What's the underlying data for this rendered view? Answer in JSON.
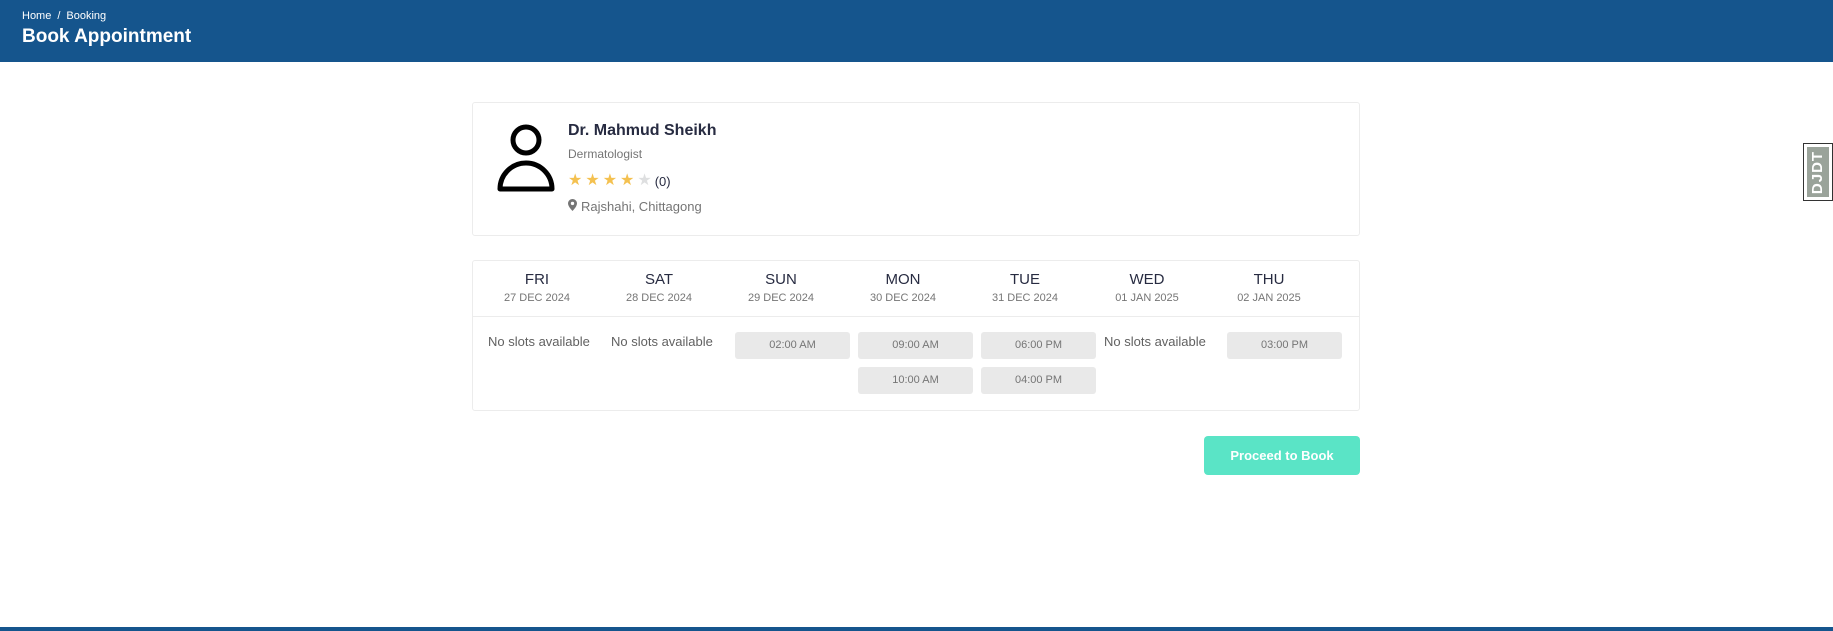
{
  "header": {
    "breadcrumb": {
      "home": "Home",
      "separator": "/",
      "current": "Booking"
    },
    "title": "Book Appointment",
    "bg_color": "#15558d"
  },
  "doctor": {
    "avatar_icon": "user-icon",
    "name": "Dr. Mahmud Sheikh",
    "specialty": "Dermatologist",
    "rating": {
      "filled": 4,
      "total": 5,
      "count_label": "(0)"
    },
    "location_icon": "map-marker-icon",
    "location": "Rajshahi, Chittagong"
  },
  "schedule": {
    "days": [
      {
        "name": "FRI",
        "date": "27 DEC 2024",
        "slots": [],
        "empty_label": "No slots available"
      },
      {
        "name": "SAT",
        "date": "28 DEC 2024",
        "slots": [],
        "empty_label": "No slots available"
      },
      {
        "name": "SUN",
        "date": "29 DEC 2024",
        "slots": [
          "02:00 AM"
        ]
      },
      {
        "name": "MON",
        "date": "30 DEC 2024",
        "slots": [
          "09:00 AM",
          "10:00 AM"
        ]
      },
      {
        "name": "TUE",
        "date": "31 DEC 2024",
        "slots": [
          "06:00 PM",
          "04:00 PM"
        ]
      },
      {
        "name": "WED",
        "date": "01 JAN 2025",
        "slots": [],
        "empty_label": "No slots available"
      },
      {
        "name": "THU",
        "date": "02 JAN 2025",
        "slots": [
          "03:00 PM"
        ]
      }
    ]
  },
  "actions": {
    "proceed_label": "Proceed to Book",
    "proceed_color": "#5ae4c6"
  },
  "debug_toolbar": {
    "label": "DJDT"
  },
  "colors": {
    "primary": "#15558d",
    "star": "#f4c150",
    "slot_bg": "#e9e9e9"
  }
}
